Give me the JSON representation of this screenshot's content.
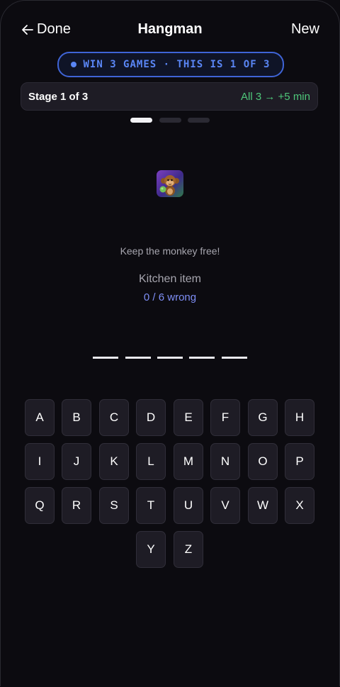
{
  "header": {
    "back_label": "Done",
    "title": "Hangman",
    "new_label": "New"
  },
  "challenge": {
    "text": "WIN 3 GAMES · THIS IS 1 OF 3",
    "accent": "#5a86f5"
  },
  "stage": {
    "label": "Stage 1 of 3",
    "reward": "All 3 → +5 min",
    "reward_color": "#4ec77a"
  },
  "progress": {
    "current": 1,
    "total": 3
  },
  "game": {
    "icon": "monkey-icon",
    "tagline": "Keep the monkey free!",
    "category": "Kitchen item",
    "wrong_count": "0 / 6 wrong",
    "word_length": 5
  },
  "keyboard": {
    "rows": [
      [
        "A",
        "B",
        "C",
        "D",
        "E",
        "F",
        "G",
        "H"
      ],
      [
        "I",
        "J",
        "K",
        "L",
        "M",
        "N",
        "O",
        "P"
      ],
      [
        "Q",
        "R",
        "S",
        "T",
        "U",
        "V",
        "W",
        "X"
      ],
      [
        "Y",
        "Z"
      ]
    ]
  }
}
